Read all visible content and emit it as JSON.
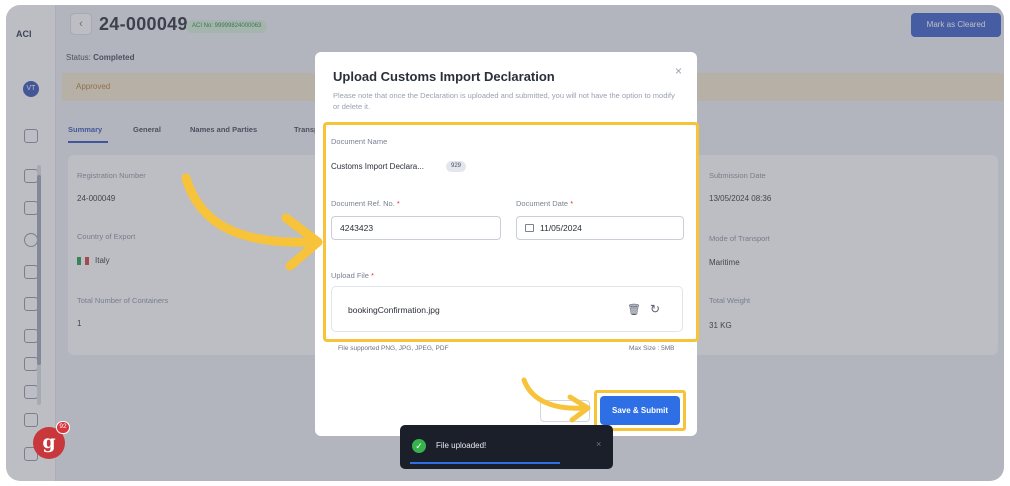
{
  "rail": {
    "brand": "ACI",
    "avatar": "VT"
  },
  "header": {
    "title": "24-000049",
    "aci_badge": "ACI No: 99999824000063",
    "status_label": "Status:",
    "status_value": "Completed",
    "mark_cleared": "Mark as Cleared"
  },
  "banner": {
    "text": "Approved"
  },
  "tabs": [
    "Summary",
    "General",
    "Names and Parties",
    "Transp"
  ],
  "details": {
    "registration_label": "Registration Number",
    "registration_value": "24-000049",
    "country_label": "Country of Export",
    "country_value": "Italy",
    "containers_label": "Total Number of Containers",
    "containers_value": "1",
    "submission_label": "Submission Date",
    "submission_value": "13/05/2024 08:36",
    "transport_label": "Mode of Transport",
    "transport_value": "Maritime",
    "weight_label": "Total Weight",
    "weight_value": "31 KG"
  },
  "modal": {
    "title": "Upload Customs Import Declaration",
    "close": "×",
    "note": "Please note that once the Declaration is uploaded and submitted, you will not have the option to modify or delete it.",
    "doc_name_label": "Document Name",
    "doc_name_value": "Customs Import Declara...",
    "doc_name_chip": "929",
    "ref_label": "Document Ref. No.",
    "ref_value": "4243423",
    "date_label": "Document Date",
    "date_value": "11/05/2024",
    "upload_label": "Upload File",
    "file_name": "bookingConfirmation.jpg",
    "supported": "File supported PNG, JPG, JPEG, PDF",
    "max_size": "Max Size : 5MB",
    "required": "*",
    "save_submit": "Save & Submit"
  },
  "toast": {
    "message": "File uploaded!",
    "close": "×"
  },
  "logo": {
    "letter": "g",
    "badge": "92"
  },
  "colors": {
    "accent": "#2f6fe6",
    "highlight": "#f6c33b",
    "primary": "#3557c8",
    "approved_bg": "#f6e7cf"
  }
}
